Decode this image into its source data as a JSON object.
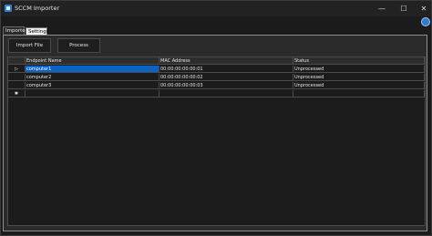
{
  "window": {
    "title": "SCCM Importer",
    "controls": {
      "minimize": "—",
      "maximize": "☐",
      "close": "✕"
    }
  },
  "tabs": [
    {
      "label": "Importer",
      "active": true
    },
    {
      "label": "Settings",
      "active": false
    }
  ],
  "toolbar": {
    "import_label": "Import File",
    "process_label": "Process"
  },
  "grid": {
    "columns": [
      "Endpoint Name",
      "MAC Address",
      "Status"
    ],
    "rows": [
      {
        "indicator": "▷",
        "name": "computer1",
        "mac": "00:00:00:00:00:01",
        "status": "Unprocessed",
        "selected": true
      },
      {
        "indicator": "",
        "name": "computer2",
        "mac": "00:00:00:00:00:02",
        "status": "Unprocessed",
        "selected": false
      },
      {
        "indicator": "",
        "name": "computer3",
        "mac": "00:00:00:00:00:03",
        "status": "Unprocessed",
        "selected": false
      }
    ],
    "new_row_indicator": "✱"
  },
  "colors": {
    "window_bg": "#1b1b1b",
    "panel_bg": "#2b2b2b",
    "selection": "#0a64c8",
    "accent": "#2f7bd0"
  }
}
